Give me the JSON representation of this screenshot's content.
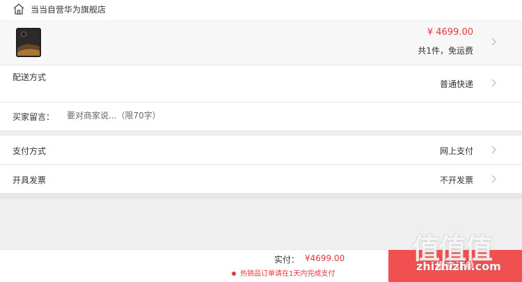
{
  "store": {
    "name": "当当自营华为旗舰店",
    "icon": "store-icon"
  },
  "product": {
    "price": "¥ 4699.00",
    "count_shipping": "共1件，免运费",
    "image": "phone-thumbnail"
  },
  "delivery": {
    "label": "配送方式",
    "value": "普通快递"
  },
  "message": {
    "label": "买家留言：",
    "placeholder": "要对商家说...（限70字）"
  },
  "payment": {
    "label": "支付方式",
    "value": "网上支付"
  },
  "invoice": {
    "label": "开具发票",
    "value": "不开发票"
  },
  "footer": {
    "pay_label": "实付：",
    "pay_amount": "¥4699.00",
    "notice": "热销品订单请在1天内完成支付",
    "submit_label": "提交订单"
  },
  "watermark": {
    "logo": "值值值",
    "site": "zhizhizhi.com"
  },
  "colors": {
    "accent": "#e4393c",
    "button": "#f05050",
    "background_gap": "#eeeeee"
  }
}
